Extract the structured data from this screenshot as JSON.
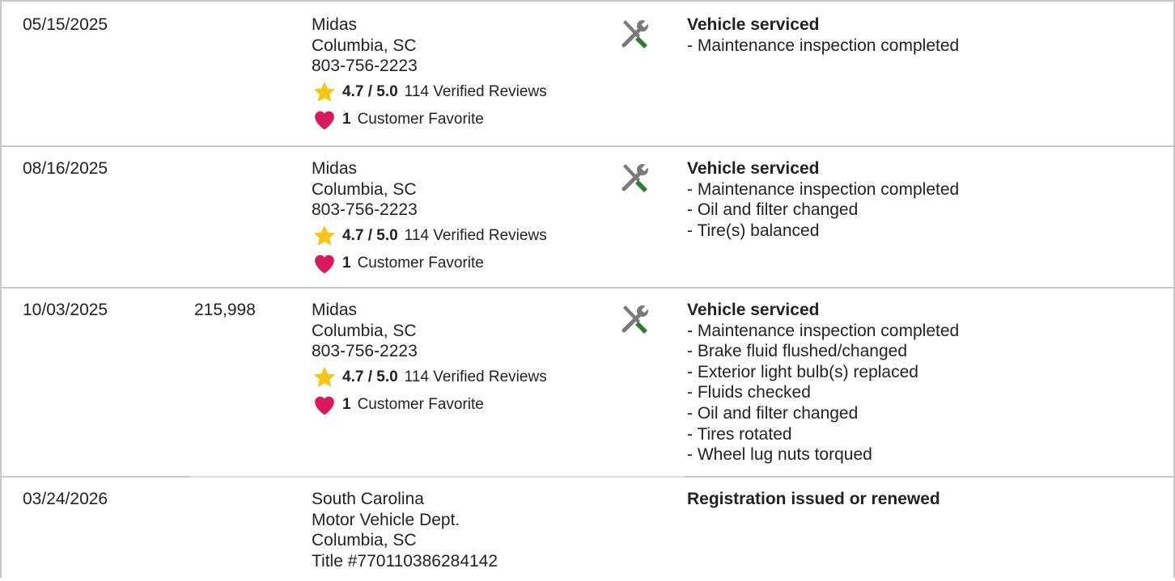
{
  "records": [
    {
      "date": "05/15/2025",
      "mileage": "",
      "source": {
        "name": "Midas",
        "location": "Columbia, SC",
        "phone": "803-756-2223",
        "rating": "4.7 / 5.0",
        "reviews": "114 Verified Reviews",
        "favorites_count": "1",
        "favorites_label": "Customer Favorite"
      },
      "icon": "service-tools-icon",
      "title": "Vehicle serviced",
      "items": [
        "Maintenance inspection completed"
      ]
    },
    {
      "date": "08/16/2025",
      "mileage": "",
      "source": {
        "name": "Midas",
        "location": "Columbia, SC",
        "phone": "803-756-2223",
        "rating": "4.7 / 5.0",
        "reviews": "114 Verified Reviews",
        "favorites_count": "1",
        "favorites_label": "Customer Favorite"
      },
      "icon": "service-tools-icon",
      "title": "Vehicle serviced",
      "items": [
        "Maintenance inspection completed",
        "Oil and filter changed",
        "Tire(s) balanced"
      ]
    },
    {
      "date": "10/03/2025",
      "mileage": "215,998",
      "source": {
        "name": "Midas",
        "location": "Columbia, SC",
        "phone": "803-756-2223",
        "rating": "4.7 / 5.0",
        "reviews": "114 Verified Reviews",
        "favorites_count": "1",
        "favorites_label": "Customer Favorite"
      },
      "icon": "service-tools-icon",
      "title": "Vehicle serviced",
      "items": [
        "Maintenance inspection completed",
        "Brake fluid flushed/changed",
        "Exterior light bulb(s) replaced",
        "Fluids checked",
        "Oil and filter changed",
        "Tires rotated",
        "Wheel lug nuts torqued"
      ]
    },
    {
      "date": "03/24/2026",
      "mileage": "",
      "source": {
        "line1": "South Carolina",
        "line2": "Motor Vehicle Dept.",
        "line3": "Columbia, SC",
        "line4": "Title #770110386284142"
      },
      "title": "Registration issued or renewed"
    }
  ],
  "colors": {
    "star": "#f5c518",
    "heart": "#d81b60",
    "wrench": "#7a7a7a",
    "screwdriver": "#2e7d32",
    "border": "#c8c8c8"
  }
}
